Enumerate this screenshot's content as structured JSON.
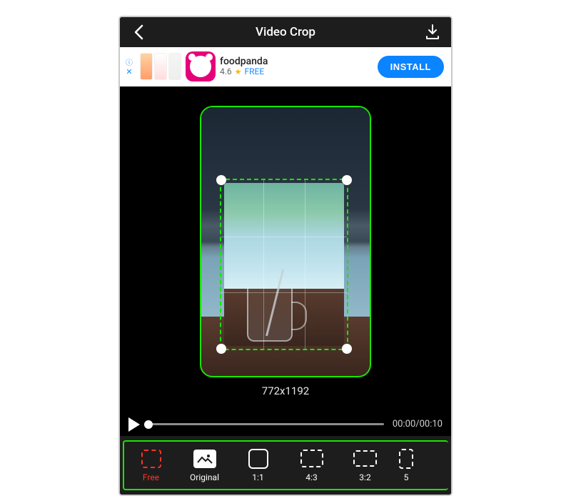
{
  "header": {
    "title": "Video Crop"
  },
  "ad": {
    "app_name": "foodpanda",
    "rating": "4.6",
    "price_label": "FREE",
    "install_label": "INSTALL"
  },
  "crop": {
    "dimensions": "772x1192"
  },
  "transport": {
    "time": "00:00/00:10"
  },
  "ratios": {
    "items": [
      {
        "label": "Free"
      },
      {
        "label": "Original"
      },
      {
        "label": "1:1"
      },
      {
        "label": "4:3"
      },
      {
        "label": "3:2"
      },
      {
        "label": "5"
      }
    ],
    "active_index": 0
  }
}
